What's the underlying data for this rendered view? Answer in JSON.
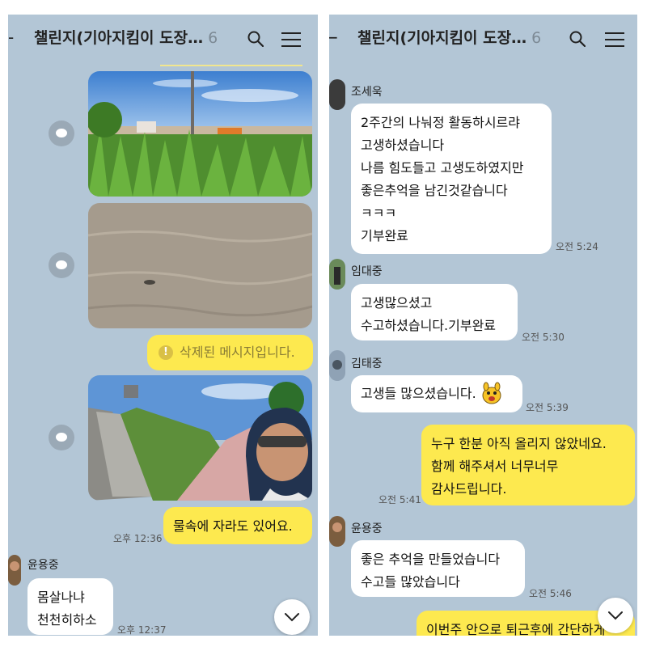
{
  "left_panel": {
    "header": {
      "title": "챌린지(기아지킴이 도장…",
      "member_count": "6",
      "back_icon": "arrow-left-icon",
      "search_icon": "search-icon",
      "menu_icon": "hamburger-menu-icon"
    },
    "deleted_message": "삭제된 메시지입니다.",
    "my_message": {
      "text": "물속에 자라도 있어요.",
      "time": "오후 12:36"
    },
    "reply": {
      "sender": "윤용중",
      "lines": [
        "몸살나냐",
        "천천히하소"
      ],
      "time": "오후 12:37"
    }
  },
  "right_panel": {
    "header": {
      "title": "챌린지(기아지킴이 도장…",
      "member_count": "6"
    },
    "messages": [
      {
        "sender": "조세욱",
        "lines": [
          "2주간의 나눠정 활동하시르랴",
          "고생하셨습니다",
          "나름 힘도들고 고생도하였지만",
          "좋은추억을 남긴것같습니다",
          "ㅋㅋㅋ",
          "기부완료"
        ],
        "time": "오전 5:24"
      },
      {
        "sender": "임대중",
        "lines": [
          "고생많으셨고",
          "수고하셨습니다.기부완료"
        ],
        "time": "오전 5:30"
      },
      {
        "sender": "김태중",
        "lines": [
          "고생들 많으셨습니다."
        ],
        "time": "오전 5:39"
      },
      {
        "sender": "",
        "lines": [
          "누구 한분 아직 올리지 않았네요.",
          "함께 해주셔서 너무너무",
          "감사드립니다."
        ],
        "time": "오전 5:41"
      },
      {
        "sender": "윤용중",
        "lines": [
          "좋은 추억을 만들었습니다",
          "수고들 많았습니다"
        ],
        "time": "오전 5:46"
      },
      {
        "sender": "",
        "lines": [
          "이번주 안으로 퇴근후에 간단하게"
        ],
        "time": ""
      }
    ]
  },
  "colors": {
    "chat_background": "#b3c6d6",
    "my_bubble": "#fde94f",
    "other_bubble": "#ffffff"
  }
}
